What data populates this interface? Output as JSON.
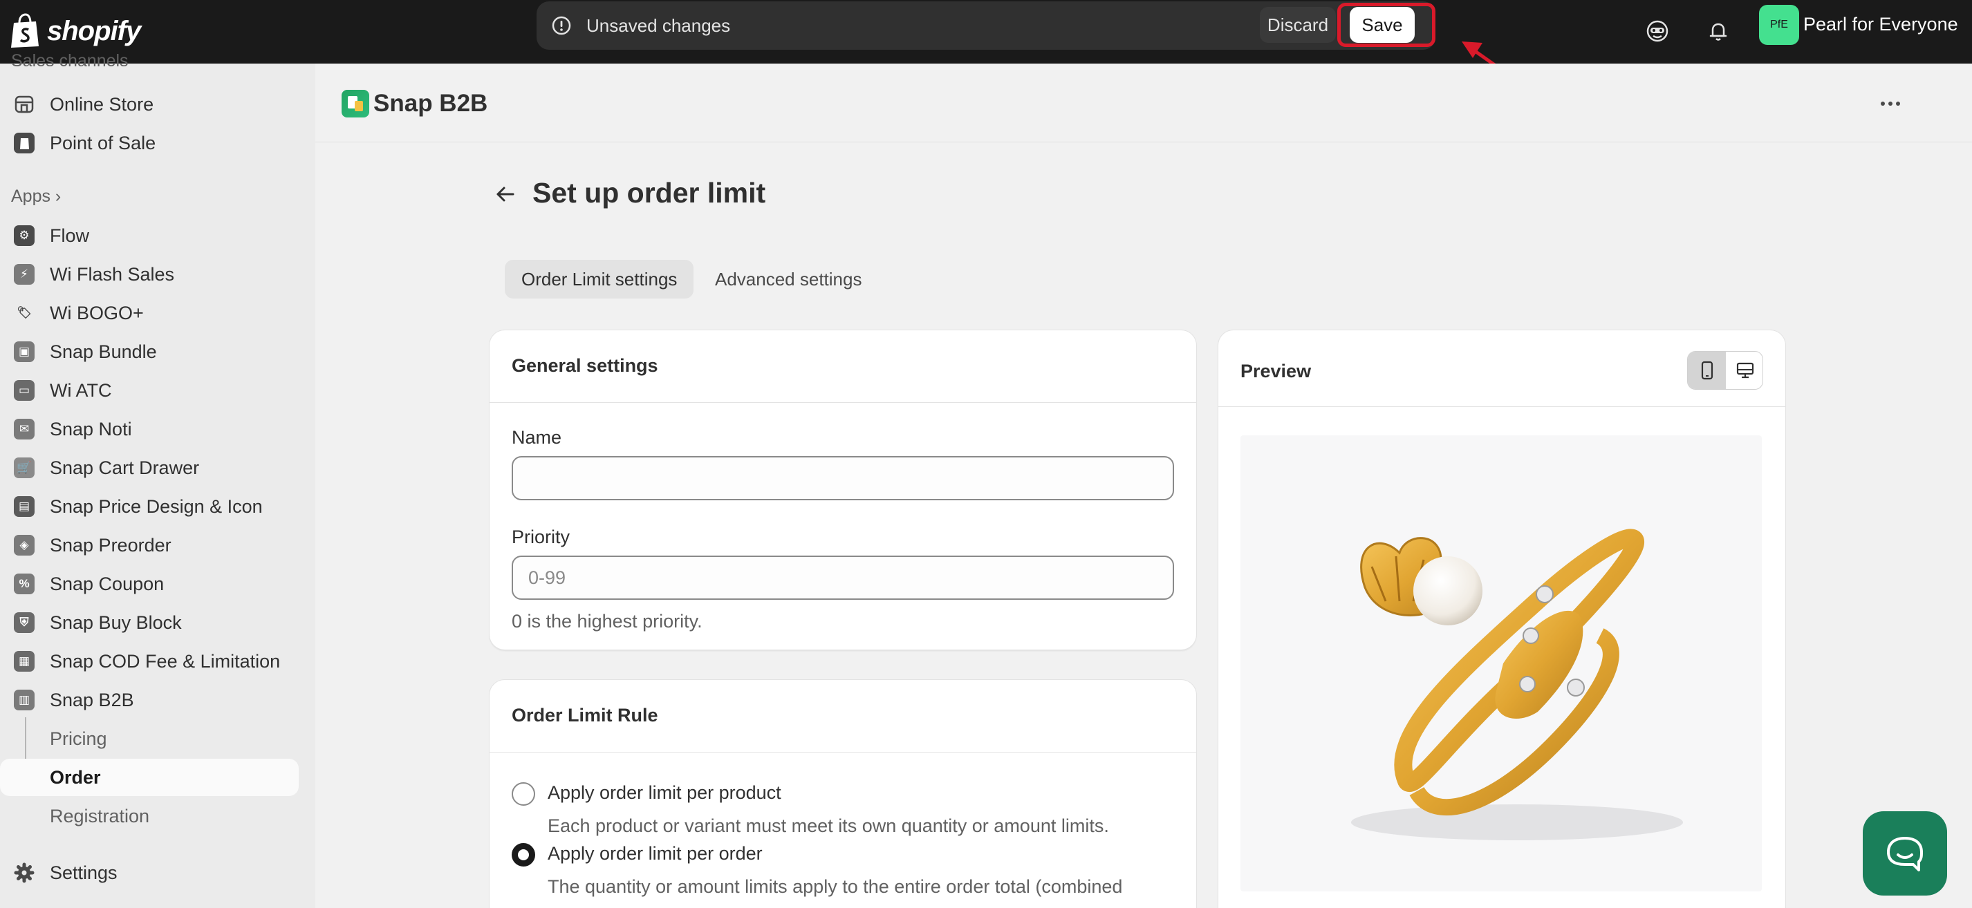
{
  "topbar": {
    "brand": "shopify",
    "unsaved_text": "Unsaved changes",
    "discard_label": "Discard",
    "save_label": "Save",
    "avatar_initials": "PfE",
    "store_name": "Pearl for Everyone"
  },
  "sidebar": {
    "partial_section": "Sales channels",
    "sales_channels": [
      {
        "label": "Online Store",
        "icon": "store-icon"
      },
      {
        "label": "Point of Sale",
        "icon": "pos-icon"
      }
    ],
    "apps_title": "Apps",
    "apps": [
      {
        "label": "Flow"
      },
      {
        "label": "Wi Flash Sales"
      },
      {
        "label": "Wi BOGO+"
      },
      {
        "label": "Snap Bundle"
      },
      {
        "label": "Wi ATC"
      },
      {
        "label": "Snap Noti"
      },
      {
        "label": "Snap Cart Drawer"
      },
      {
        "label": "Snap Price Design & Icon"
      },
      {
        "label": "Snap Preorder"
      },
      {
        "label": "Snap Coupon"
      },
      {
        "label": "Snap Buy Block"
      },
      {
        "label": "Snap COD Fee & Limitation"
      },
      {
        "label": "Snap B2B"
      }
    ],
    "sub_items": [
      {
        "label": "Pricing"
      },
      {
        "label": "Order"
      },
      {
        "label": "Registration"
      }
    ],
    "settings_label": "Settings"
  },
  "app": {
    "title": "Snap B2B"
  },
  "page": {
    "title": "Set up order limit",
    "tabs": [
      {
        "label": "Order Limit settings",
        "active": true
      },
      {
        "label": "Advanced settings",
        "active": false
      }
    ]
  },
  "general_settings": {
    "title": "General settings",
    "name_label": "Name",
    "name_value": "",
    "priority_label": "Priority",
    "priority_placeholder": "0-99",
    "priority_help": "0 is the highest priority."
  },
  "order_limit_rule": {
    "title": "Order Limit Rule",
    "options": [
      {
        "label": "Apply order limit per product",
        "help": "Each product or variant must meet its own quantity or amount limits.",
        "checked": false
      },
      {
        "label": "Apply order limit per order",
        "help": "The quantity or amount limits apply to the entire order total (combined",
        "checked": true
      }
    ]
  },
  "preview": {
    "title": "Preview",
    "device": "mobile"
  },
  "colors": {
    "topbar_bg": "#1a1a1a",
    "highlight": "#d91a2a",
    "avatar_bg": "#44e08f",
    "chat_bg": "#1a7f5a"
  }
}
